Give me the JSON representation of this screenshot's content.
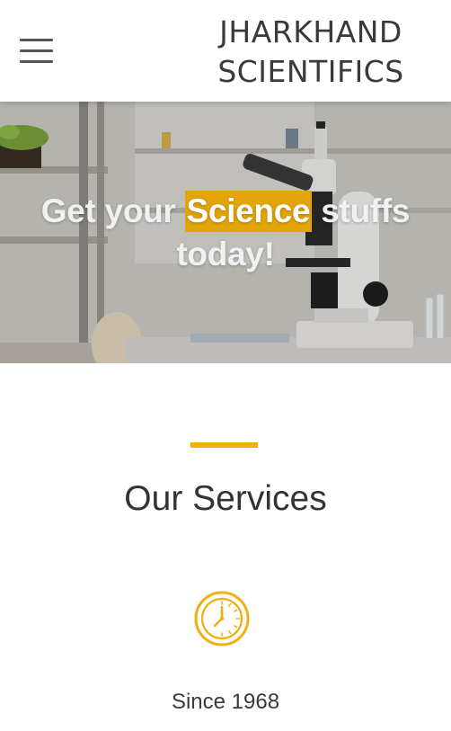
{
  "header": {
    "menu_icon": "hamburger-menu-icon",
    "brand_line1": "JHARKHAND",
    "brand_line2": "SCIENTIFICS"
  },
  "hero": {
    "headline_part1": "Get your ",
    "headline_highlight": "Science",
    "headline_part2": " stuffs",
    "headline_line2": "today!",
    "highlight_color": "#e3a50a",
    "image": "laboratory-microscope-photo"
  },
  "services": {
    "title": "Our Services",
    "accent_color": "#f0b010",
    "items": [
      {
        "icon": "clock-icon",
        "label": "Since 1968"
      }
    ]
  }
}
